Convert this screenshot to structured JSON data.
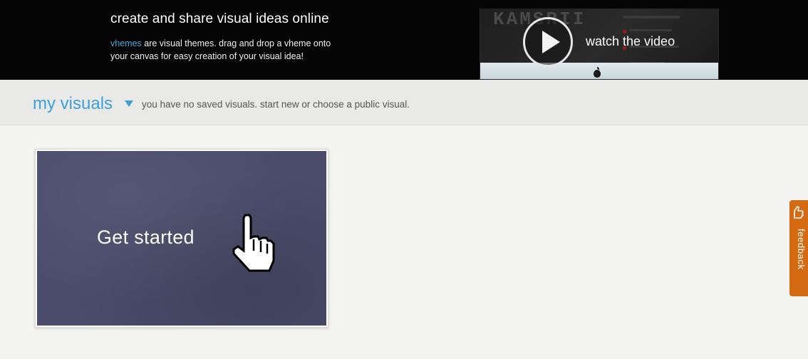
{
  "hero": {
    "title": "create and share visual ideas online",
    "desc_link": "vhemes",
    "desc_rest": " are visual themes. drag and drop a vheme onto",
    "desc_line2": "your canvas for easy creation of your visual idea!",
    "video_label": "watch the video",
    "video_letters": "KAMSRII"
  },
  "my_visuals": {
    "title": "my visuals",
    "message": "you have no saved visuals. start new or choose a public visual."
  },
  "card": {
    "label": "Get started"
  },
  "feedback": {
    "label": "feedback"
  },
  "colors": {
    "accent_blue": "#3f9fd8",
    "feedback_orange": "#d46a12",
    "card_background": "#4b4c6b"
  }
}
